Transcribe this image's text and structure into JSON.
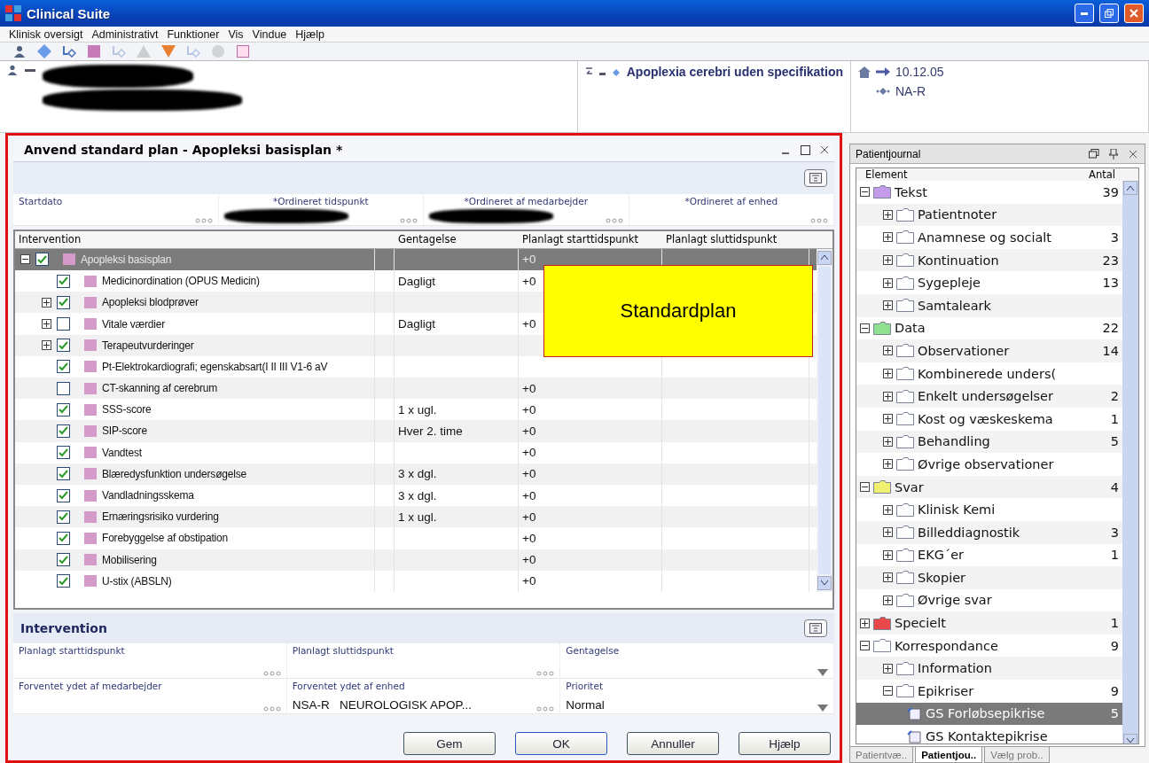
{
  "window": {
    "title": "Clinical Suite"
  },
  "menu": [
    "Klinisk oversigt",
    "Administrativt",
    "Funktioner",
    "Vis",
    "Vindue",
    "Hjælp"
  ],
  "toolbar": [
    {
      "kind": "person",
      "disabled": false
    },
    {
      "kind": "diamond",
      "disabled": false
    },
    {
      "kind": "link",
      "disabled": false
    },
    {
      "kind": "intervention",
      "disabled": false
    },
    {
      "kind": "link",
      "disabled": true
    },
    {
      "kind": "triangle",
      "disabled": true
    },
    {
      "kind": "shield",
      "disabled": false
    },
    {
      "kind": "link",
      "disabled": true
    },
    {
      "kind": "circle",
      "disabled": true
    },
    {
      "kind": "note",
      "disabled": false
    }
  ],
  "patient_header": {
    "diagnosis": "Apoplexia cerebri uden specifikation",
    "date": "10.12.05",
    "unit": "NA-R"
  },
  "dialog": {
    "title": "Anvend standard plan - Apopleksi basisplan *",
    "header_fields": [
      {
        "label": "Startdato",
        "redacted": false
      },
      {
        "label": "*Ordineret tidspunkt",
        "redacted": true
      },
      {
        "label": "*Ordineret af medarbejder",
        "redacted": true
      },
      {
        "label": "*Ordineret af enhed",
        "redacted": false
      }
    ],
    "table": {
      "columns": [
        "Intervention",
        "Gentagelse",
        "Planlagt starttidspunkt",
        "Planlagt sluttidspunkt"
      ],
      "root": {
        "name": "Apopleksi basisplan",
        "checked": true,
        "expanded": true,
        "selected": true,
        "start": "+0"
      },
      "rows": [
        {
          "kind": "item",
          "name": "Medicinordination (OPUS Medicin)",
          "checked": true,
          "selected": false,
          "repeat": "Dagligt",
          "start": "+0"
        },
        {
          "kind": "group",
          "name": "Apopleksi blodprøver",
          "checked": true,
          "expanded": false,
          "selected": false
        },
        {
          "kind": "group",
          "name": "Vitale værdier",
          "checked": false,
          "expanded": false,
          "selected": false,
          "repeat": "Dagligt",
          "start": "+0"
        },
        {
          "kind": "group",
          "name": "Terapeutvurderinger",
          "checked": true,
          "expanded": false,
          "selected": false
        },
        {
          "kind": "item",
          "name": "Pt-Elektrokardiografi; egenskabsart(I II III V1-6 aV",
          "checked": true,
          "selected": false
        },
        {
          "kind": "item",
          "name": "CT-skanning af cerebrum",
          "checked": false,
          "selected": false,
          "start": "+0"
        },
        {
          "kind": "item",
          "name": "SSS-score",
          "checked": true,
          "selected": false,
          "repeat": "1 x ugl.",
          "start": "+0"
        },
        {
          "kind": "item",
          "name": "SIP-score",
          "checked": true,
          "selected": false,
          "repeat": "Hver 2. time",
          "start": "+0"
        },
        {
          "kind": "item",
          "name": "Vandtest",
          "checked": true,
          "selected": false,
          "start": "+0"
        },
        {
          "kind": "item",
          "name": "Blæredysfunktion undersøgelse",
          "checked": true,
          "selected": false,
          "repeat": "3 x dgl.",
          "start": "+0"
        },
        {
          "kind": "item",
          "name": "Vandladningsskema",
          "checked": true,
          "selected": false,
          "repeat": "3 x dgl.",
          "start": "+0"
        },
        {
          "kind": "item",
          "name": "Ernæringsrisiko vurdering",
          "checked": true,
          "selected": false,
          "repeat": "1 x ugl.",
          "start": "+0"
        },
        {
          "kind": "item",
          "name": "Forebyggelse af obstipation",
          "checked": true,
          "selected": false,
          "start": "+0"
        },
        {
          "kind": "item",
          "name": "Mobilisering",
          "checked": true,
          "selected": false,
          "start": "+0"
        },
        {
          "kind": "item",
          "name": "U-stix (ABSLN)",
          "checked": true,
          "selected": false,
          "start": "+0"
        }
      ]
    },
    "callout": "Standardplan",
    "section": {
      "title": "Intervention",
      "fields": [
        {
          "kind": "picker",
          "label": "Planlagt starttidspunkt"
        },
        {
          "kind": "picker",
          "label": "Planlagt sluttidspunkt"
        },
        {
          "kind": "dropdown",
          "label": "Gentagelse"
        },
        {
          "kind": "picker",
          "label": "Forventet ydet af medarbejder"
        },
        {
          "kind": "picker",
          "label": "Forventet ydet af enhed",
          "value": "NSA-R   NEUROLOGISK APOP..."
        },
        {
          "kind": "dropdown",
          "label": "Prioritet",
          "value": "Normal"
        }
      ]
    },
    "buttons": [
      {
        "label": "Gem",
        "default": false
      },
      {
        "label": "OK",
        "default": true
      },
      {
        "label": "Annuller",
        "default": false
      },
      {
        "label": "Hjælp",
        "default": false
      }
    ]
  },
  "journal": {
    "title": "Patientjournal",
    "columns": [
      "Element",
      "Antal"
    ],
    "tree": [
      {
        "kind": "folder",
        "label": "Tekst",
        "count": "39",
        "color": "#c39be8",
        "expanded": true,
        "selected": false,
        "children": [
          {
            "kind": "folder",
            "label": "Patientnoter",
            "expanded": false,
            "selected": false
          },
          {
            "kind": "folder",
            "label": "Anamnese og socialt",
            "count": "3",
            "expanded": false,
            "selected": false
          },
          {
            "kind": "folder",
            "label": "Kontinuation",
            "count": "23",
            "expanded": false,
            "selected": false
          },
          {
            "kind": "folder",
            "label": "Sygepleje",
            "count": "13",
            "expanded": false,
            "selected": false
          },
          {
            "kind": "folder",
            "label": "Samtaleark",
            "expanded": false,
            "selected": false
          }
        ]
      },
      {
        "kind": "folder",
        "label": "Data",
        "count": "22",
        "color": "#90e090",
        "expanded": true,
        "selected": false,
        "children": [
          {
            "kind": "folder",
            "label": "Observationer",
            "count": "14",
            "expanded": false,
            "selected": false
          },
          {
            "kind": "folder",
            "label": "Kombinerede unders(",
            "expanded": false,
            "selected": false
          },
          {
            "kind": "folder",
            "label": "Enkelt undersøgelser",
            "count": "2",
            "expanded": false,
            "selected": false
          },
          {
            "kind": "folder",
            "label": "Kost og væskeskema",
            "count": "1",
            "expanded": false,
            "selected": false
          },
          {
            "kind": "folder",
            "label": "Behandling",
            "count": "5",
            "expanded": false,
            "selected": false
          },
          {
            "kind": "folder",
            "label": "Øvrige observationer",
            "expanded": false,
            "selected": false
          }
        ]
      },
      {
        "kind": "folder",
        "label": "Svar",
        "count": "4",
        "color": "#f0f070",
        "expanded": true,
        "selected": false,
        "children": [
          {
            "kind": "folder",
            "label": "Klinisk Kemi",
            "expanded": false,
            "selected": false
          },
          {
            "kind": "folder",
            "label": "Billeddiagnostik",
            "count": "3",
            "expanded": false,
            "selected": false
          },
          {
            "kind": "folder",
            "label": "EKG´er",
            "count": "1",
            "expanded": false,
            "selected": false
          },
          {
            "kind": "folder",
            "label": "Skopier",
            "expanded": false,
            "selected": false
          },
          {
            "kind": "folder",
            "label": "Øvrige svar",
            "expanded": false,
            "selected": false
          }
        ]
      },
      {
        "kind": "folder",
        "label": "Specielt",
        "count": "1",
        "color": "#e84848",
        "expanded": false,
        "selected": false
      },
      {
        "kind": "folder",
        "label": "Korrespondance",
        "count": "9",
        "expanded": true,
        "selected": false,
        "children": [
          {
            "kind": "folder",
            "label": "Information",
            "expanded": false,
            "selected": false
          },
          {
            "kind": "folder",
            "label": "Epikriser",
            "count": "9",
            "expanded": true,
            "selected": false,
            "children": [
              {
                "kind": "document",
                "label": "GS Forløbsepikrise",
                "count": "5",
                "selected": true
              },
              {
                "kind": "document",
                "label": "GS Kontaktepikrise",
                "selected": false
              }
            ]
          }
        ]
      }
    ]
  },
  "bottom_tabs": [
    {
      "label": "Patientvæ..",
      "selected": false
    },
    {
      "label": "Patientjou..",
      "selected": true
    },
    {
      "label": "Vælg prob..",
      "selected": false
    }
  ]
}
